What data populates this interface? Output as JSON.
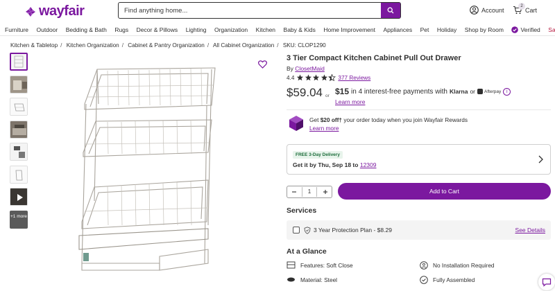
{
  "header": {
    "logo_text": "wayfair",
    "search_placeholder": "Find anything home...",
    "account_label": "Account",
    "cart_label": "Cart",
    "cart_count": "2"
  },
  "nav": {
    "items": [
      "Furniture",
      "Outdoor",
      "Bedding & Bath",
      "Rugs",
      "Decor & Pillows",
      "Lighting",
      "Organization",
      "Kitchen",
      "Baby & Kids",
      "Home Improvement",
      "Appliances",
      "Pet",
      "Holiday",
      "Shop by Room"
    ],
    "verified_label": "Verified",
    "sale_label": "Sale"
  },
  "breadcrumb": {
    "items": [
      "Kitchen & Tabletop",
      "Kitchen Organization",
      "Cabinet & Pantry Organization",
      "All Cabinet Organization"
    ],
    "sku": "SKU: CLOP1290"
  },
  "gallery": {
    "more_label": "+1 more"
  },
  "product": {
    "title": "3 Tier Compact Kitchen Cabinet Pull Out Drawer",
    "by_prefix": "By",
    "brand": "ClosetMaid",
    "rating_value": "4.4",
    "rating_stars": 4.4,
    "reviews_label": "377 Reviews",
    "price": "$59.04",
    "or_label": "or",
    "installment_amount": "$15",
    "installment_text": "in 4 interest-free payments with",
    "klarna_label": "Klarna",
    "or_label_2": "or",
    "afterpay_label": "Afterpay",
    "learn_more_label": "Learn more"
  },
  "rewards": {
    "prefix": "Get",
    "amount": "$20 off†",
    "suffix": "your order today when you join Wayfair Rewards",
    "learn_more_label": "Learn more"
  },
  "delivery": {
    "badge": "FREE 3-Day Delivery",
    "text": "Get it by Thu, Sep 18 to",
    "zip": "12309"
  },
  "cart": {
    "quantity": "1",
    "add_label": "Add to Cart"
  },
  "services": {
    "heading": "Services",
    "plan_label": "3 Year Protection Plan - $8.29",
    "see_details_label": "See Details"
  },
  "glance": {
    "heading": "At a Glance",
    "features": "Features: Soft Close",
    "installation": "No Installation Required",
    "material": "Material: Steel",
    "assembled": "Fully Assembled"
  },
  "colors": {
    "brand": "#7b189f",
    "text": "#2f2f2f"
  }
}
